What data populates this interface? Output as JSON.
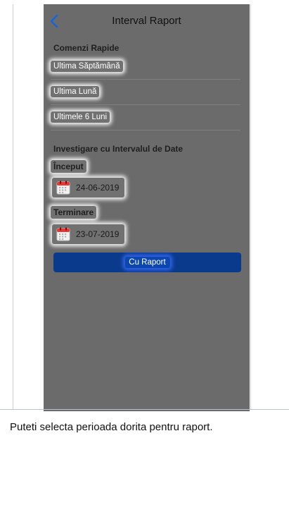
{
  "header": {
    "back_icon": "chevron-left-icon",
    "title": "Interval Raport"
  },
  "quick": {
    "heading": "Comenzi Rapide",
    "items": [
      {
        "label": "Ultima Săptămână"
      },
      {
        "label": "Ultima Lună"
      },
      {
        "label": "Ultimele 6 Luni"
      }
    ]
  },
  "range": {
    "heading": "Investigare cu Intervalul de Date",
    "start_label": "Început",
    "start_date": "24-06-2019",
    "end_label": "Terminare",
    "end_date": "23-07-2019",
    "calendar_icon": "calendar-icon"
  },
  "report_button": {
    "label": "Cu Raport",
    "color": "#0a3a8c"
  },
  "caption": "Puteti selecta perioada dorita pentru raport."
}
